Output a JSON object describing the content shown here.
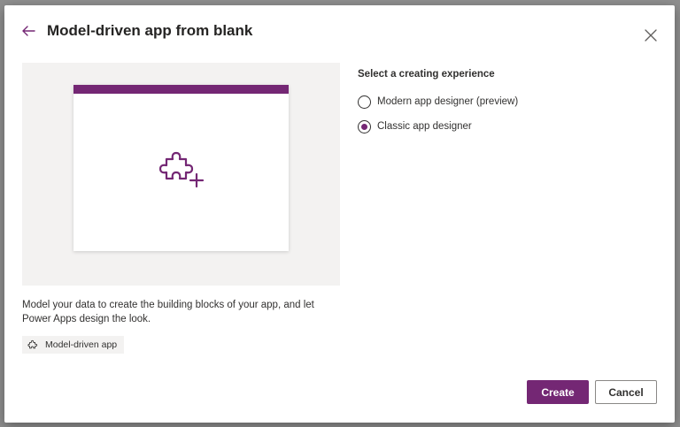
{
  "dialog": {
    "title": "Model-driven app from blank",
    "back_icon": "arrow-left-icon",
    "close_icon": "close-icon"
  },
  "preview": {
    "icon": "puzzle-add-icon",
    "description": "Model your data to create the building blocks of your app, and let Power Apps design the look.",
    "tag": {
      "icon": "puzzle-icon",
      "label": "Model-driven app"
    }
  },
  "experience": {
    "label": "Select a creating experience",
    "options": [
      {
        "label": "Modern app designer (preview)",
        "selected": false
      },
      {
        "label": "Classic app designer",
        "selected": true
      }
    ]
  },
  "footer": {
    "create_label": "Create",
    "cancel_label": "Cancel"
  },
  "colors": {
    "accent": "#742774",
    "preview_bg": "#f3f2f1",
    "text": "#323130"
  }
}
